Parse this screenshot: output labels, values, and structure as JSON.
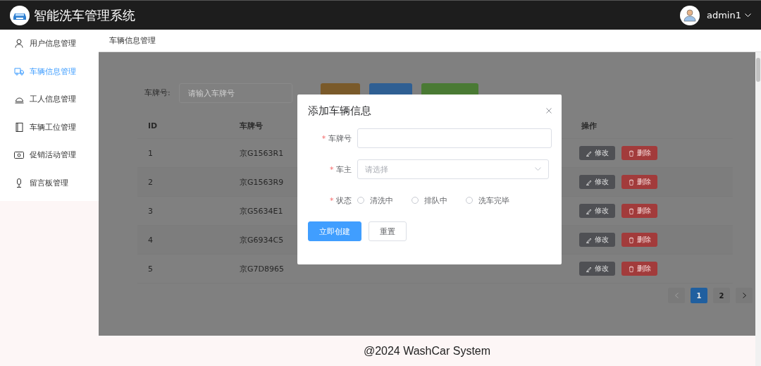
{
  "header": {
    "title": "智能洗车管理系统",
    "user": "admin1"
  },
  "sidebar": {
    "items": [
      {
        "label": "用户信息管理",
        "selected": false
      },
      {
        "label": "车辆信息管理",
        "selected": true
      },
      {
        "label": "工人信息管理",
        "selected": false
      },
      {
        "label": "车辆工位管理",
        "selected": false
      },
      {
        "label": "促销活动管理",
        "selected": false
      },
      {
        "label": "留言板管理",
        "selected": false
      }
    ]
  },
  "breadcrumb": "车辆信息管理",
  "search": {
    "label": "车牌号:",
    "placeholder": "请输入车牌号",
    "buttons": [
      {
        "kind": "warning"
      },
      {
        "kind": "primary"
      },
      {
        "kind": "success"
      }
    ]
  },
  "table": {
    "headers": {
      "id": "ID",
      "plate": "车牌号",
      "actions": "操作"
    },
    "rows": [
      {
        "id": "1",
        "plate": "京G1563R1",
        "actions": [
          {
            "label": "修改",
            "kind": "edit"
          },
          {
            "label": "删除",
            "kind": "delete"
          }
        ]
      },
      {
        "id": "2",
        "plate": "京G1563R9",
        "actions": [
          {
            "label": "修改",
            "kind": "edit"
          },
          {
            "label": "删除",
            "kind": "delete"
          }
        ]
      },
      {
        "id": "3",
        "plate": "京G5634E1",
        "actions": [
          {
            "label": "修改",
            "kind": "edit"
          },
          {
            "label": "删除",
            "kind": "delete"
          }
        ]
      },
      {
        "id": "4",
        "plate": "京G6934C5",
        "actions": [
          {
            "label": "修改",
            "kind": "edit"
          },
          {
            "label": "删除",
            "kind": "delete"
          }
        ]
      },
      {
        "id": "5",
        "plate": "京G7D8965",
        "actions": [
          {
            "label": "修改",
            "kind": "edit"
          },
          {
            "label": "删除",
            "kind": "delete"
          }
        ]
      }
    ]
  },
  "pagination": {
    "prev_disabled": true,
    "pages": [
      {
        "label": "1",
        "selected": true
      },
      {
        "label": "2",
        "selected": false
      }
    ]
  },
  "footer": "@2024 WashCar System",
  "dialog": {
    "title": "添加车辆信息",
    "fields": [
      {
        "kind": "input",
        "required_mark": "*",
        "label": "车牌号"
      },
      {
        "kind": "select",
        "required_mark": "*",
        "label": "车主",
        "placeholder": "请选择"
      },
      {
        "kind": "radio",
        "required_mark": "*",
        "label": "状态",
        "options": [
          {
            "label": "清洗中",
            "selected": false
          },
          {
            "label": "排队中",
            "selected": false
          },
          {
            "label": "洗车完毕",
            "selected": false
          }
        ]
      }
    ],
    "buttons": [
      {
        "label": "立即创建",
        "kind": "primary"
      },
      {
        "label": "重置",
        "kind": "default"
      }
    ]
  }
}
